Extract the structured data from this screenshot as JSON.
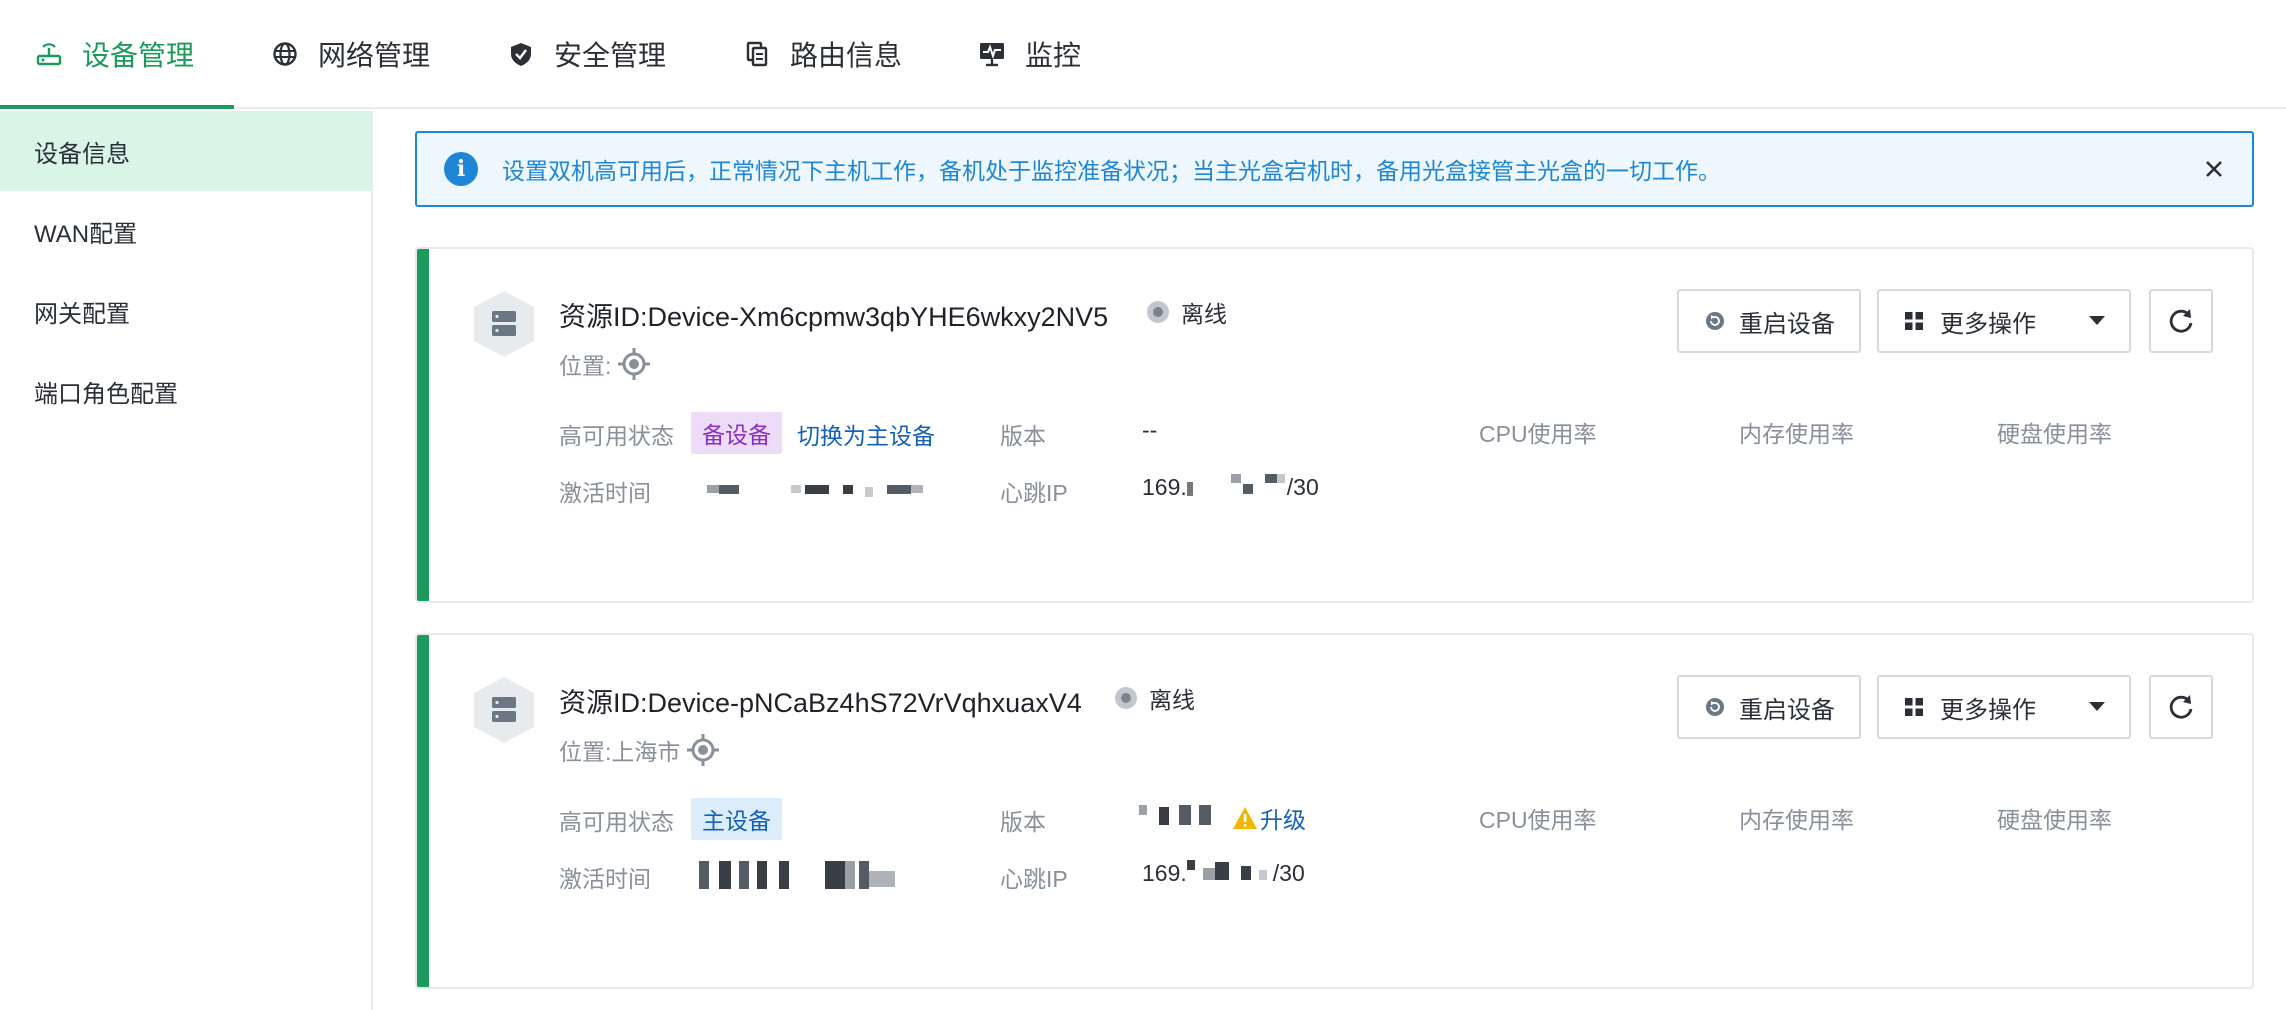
{
  "colors": {
    "accent": "#1a9b5b",
    "info": "#1f86d6",
    "link": "#1560b8",
    "warning": "#f1b600",
    "backup_tag_text": "#8a2fc8"
  },
  "nav": {
    "tabs": [
      {
        "label": "设备管理",
        "icon": "router-icon",
        "active": true
      },
      {
        "label": "网络管理",
        "icon": "globe-icon"
      },
      {
        "label": "安全管理",
        "icon": "shield-icon"
      },
      {
        "label": "路由信息",
        "icon": "route-icon"
      },
      {
        "label": "监控",
        "icon": "monitor-icon"
      }
    ]
  },
  "sidebar": {
    "items": [
      {
        "label": "设备信息",
        "active": true
      },
      {
        "label": "WAN配置"
      },
      {
        "label": "网关配置"
      },
      {
        "label": "端口角色配置"
      }
    ]
  },
  "alert": {
    "text": "设置双机高可用后，正常情况下主机工作，备机处于监控准备状况；当主光盒宕机时，备用光盒接管主光盒的一切工作。",
    "icon": "info-icon",
    "close_icon": "close-icon"
  },
  "devices": [
    {
      "resource_id": "资源ID:Device-Xm6cpmw3qbYHE6wkxy2NV5",
      "status": "离线",
      "location": "位置:",
      "ha_label": "高可用状态",
      "ha_tag": "备设备",
      "switch_link": "切换为主设备",
      "version_label": "版本",
      "version_value": "--",
      "cpu_label": "CPU使用率",
      "mem_label": "内存使用率",
      "disk_label": "硬盘使用率",
      "activate_label": "激活时间",
      "heartbeat_label": "心跳IP",
      "heartbeat_prefix": "169.",
      "heartbeat_suffix": "/30",
      "restart_button": "重启设备",
      "more_button": "更多操作"
    },
    {
      "resource_id": "资源ID:Device-pNCaBz4hS72VrVqhxuaxV4",
      "status": "离线",
      "location": "位置:上海市",
      "ha_label": "高可用状态",
      "ha_tag": "主设备",
      "upgrade_link": "升级",
      "version_label": "版本",
      "cpu_label": "CPU使用率",
      "mem_label": "内存使用率",
      "disk_label": "硬盘使用率",
      "activate_label": "激活时间",
      "heartbeat_label": "心跳IP",
      "heartbeat_prefix": "169.",
      "heartbeat_suffix": "/30",
      "restart_button": "重启设备",
      "more_button": "更多操作"
    }
  ]
}
